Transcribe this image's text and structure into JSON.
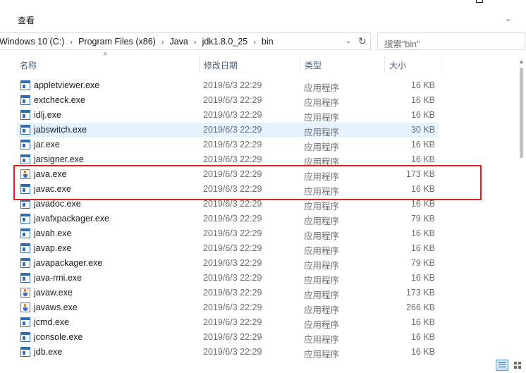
{
  "ribbon": {
    "view_tab": "查看",
    "toggle_glyph": "⌄"
  },
  "address_bar": {
    "crumbs": [
      "Windows 10 (C:)",
      "Program Files (x86)",
      "Java",
      "jdk1.8.0_25",
      "bin"
    ],
    "separator": "›",
    "dropdown_glyph": "⌄",
    "refresh_glyph": "↻"
  },
  "search": {
    "placeholder": "搜索\"bin\""
  },
  "columns": {
    "name": "名称",
    "date": "修改日期",
    "type": "类型",
    "size": "大小",
    "sort_glyph": "^"
  },
  "files": [
    {
      "name": "appletviewer.exe",
      "date": "2019/6/3 22:29",
      "type": "应用程序",
      "size": "16 KB",
      "icon": "exe-icon"
    },
    {
      "name": "extcheck.exe",
      "date": "2019/6/3 22:29",
      "type": "应用程序",
      "size": "16 KB",
      "icon": "exe-icon"
    },
    {
      "name": "idlj.exe",
      "date": "2019/6/3 22:29",
      "type": "应用程序",
      "size": "16 KB",
      "icon": "exe-icon"
    },
    {
      "name": "jabswitch.exe",
      "date": "2019/6/3 22:29",
      "type": "应用程序",
      "size": "30 KB",
      "icon": "exe-icon",
      "selected": true
    },
    {
      "name": "jar.exe",
      "date": "2019/6/3 22:29",
      "type": "应用程序",
      "size": "16 KB",
      "icon": "exe-icon"
    },
    {
      "name": "jarsigner.exe",
      "date": "2019/6/3 22:29",
      "type": "应用程序",
      "size": "16 KB",
      "icon": "exe-icon"
    },
    {
      "name": "java.exe",
      "date": "2019/6/3 22:29",
      "type": "应用程序",
      "size": "173 KB",
      "icon": "java-icon"
    },
    {
      "name": "javac.exe",
      "date": "2019/6/3 22:29",
      "type": "应用程序",
      "size": "16 KB",
      "icon": "exe-icon"
    },
    {
      "name": "javadoc.exe",
      "date": "2019/6/3 22:29",
      "type": "应用程序",
      "size": "16 KB",
      "icon": "exe-icon"
    },
    {
      "name": "javafxpackager.exe",
      "date": "2019/6/3 22:29",
      "type": "应用程序",
      "size": "79 KB",
      "icon": "exe-icon"
    },
    {
      "name": "javah.exe",
      "date": "2019/6/3 22:29",
      "type": "应用程序",
      "size": "16 KB",
      "icon": "exe-icon"
    },
    {
      "name": "javap.exe",
      "date": "2019/6/3 22:29",
      "type": "应用程序",
      "size": "16 KB",
      "icon": "exe-icon"
    },
    {
      "name": "javapackager.exe",
      "date": "2019/6/3 22:29",
      "type": "应用程序",
      "size": "79 KB",
      "icon": "exe-icon"
    },
    {
      "name": "java-rmi.exe",
      "date": "2019/6/3 22:29",
      "type": "应用程序",
      "size": "16 KB",
      "icon": "exe-icon"
    },
    {
      "name": "javaw.exe",
      "date": "2019/6/3 22:29",
      "type": "应用程序",
      "size": "173 KB",
      "icon": "java-icon"
    },
    {
      "name": "javaws.exe",
      "date": "2019/6/3 22:29",
      "type": "应用程序",
      "size": "266 KB",
      "icon": "java-icon"
    },
    {
      "name": "jcmd.exe",
      "date": "2019/6/3 22:29",
      "type": "应用程序",
      "size": "16 KB",
      "icon": "exe-icon"
    },
    {
      "name": "jconsole.exe",
      "date": "2019/6/3 22:29",
      "type": "应用程序",
      "size": "16 KB",
      "icon": "exe-icon"
    },
    {
      "name": "jdb.exe",
      "date": "2019/6/3 22:29",
      "type": "应用程序",
      "size": "16 KB",
      "icon": "exe-icon"
    }
  ],
  "scrollbar": {
    "up_glyph": "▲"
  },
  "colors": {
    "highlight": "#e02020",
    "selection": "#e5f3ff",
    "header_text": "#4c607a"
  }
}
